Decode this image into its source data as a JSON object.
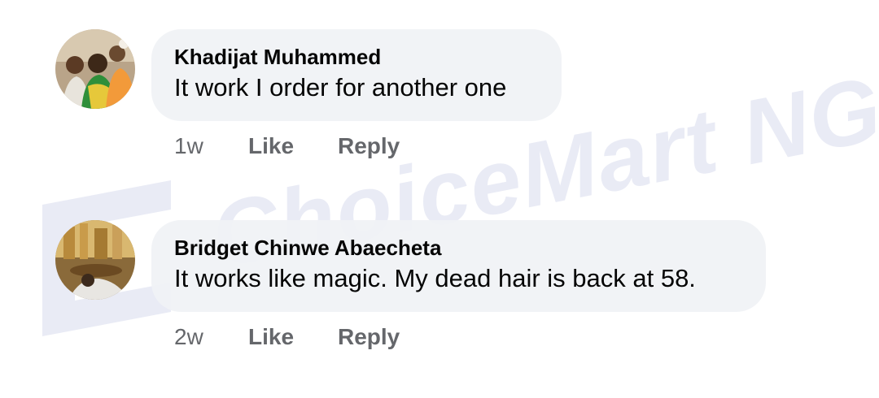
{
  "watermark": {
    "text": "ChoiceMart NG"
  },
  "comments": [
    {
      "author": "Khadijat Muhammed",
      "text": "It work I order for another one",
      "time": "1w",
      "like_label": "Like",
      "reply_label": "Reply"
    },
    {
      "author": "Bridget Chinwe Abaecheta",
      "text": "It works like magic. My dead hair is back at 58.",
      "time": "2w",
      "like_label": "Like",
      "reply_label": "Reply"
    }
  ],
  "colors": {
    "bubble": "#f0f2f5",
    "text": "#050505",
    "meta": "#65676b",
    "watermark": "#e9ebf5"
  }
}
